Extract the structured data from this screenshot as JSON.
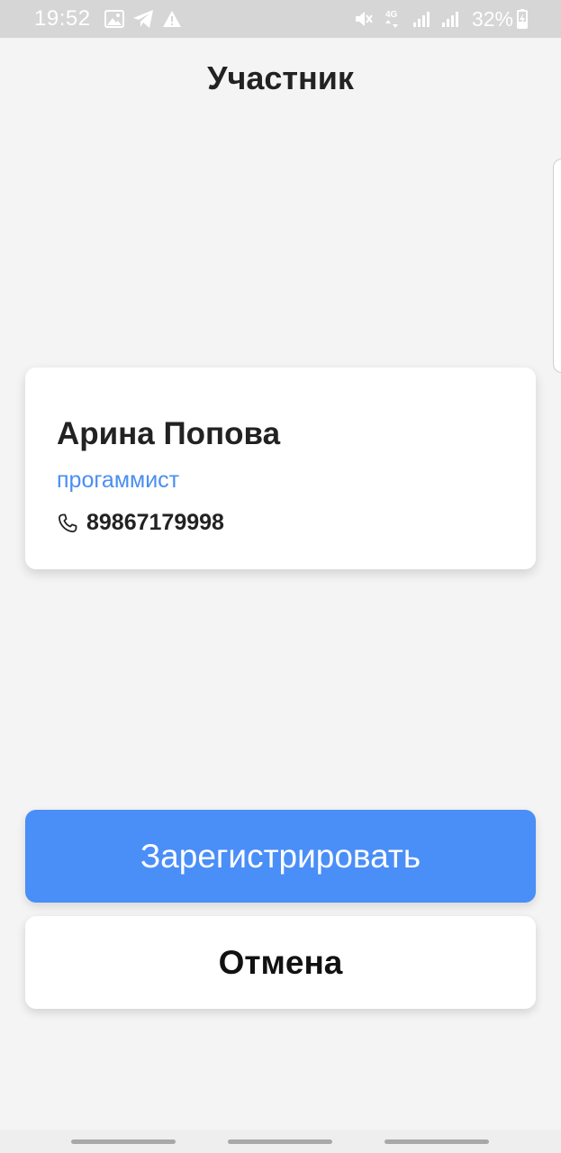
{
  "status_bar": {
    "time": "19:52",
    "battery": "32%",
    "network_label": "4G",
    "icons": [
      "image-icon",
      "telegram-icon",
      "warning-icon",
      "mute-icon",
      "network-4g-icon",
      "signal-icon",
      "signal-icon",
      "battery-charging-icon"
    ]
  },
  "page": {
    "title": "Участник"
  },
  "participant": {
    "name": "Арина Попова",
    "role": "прогаммист",
    "phone": "89867179998",
    "phone_icon": "phone-icon"
  },
  "actions": {
    "register_label": "Зарегистрировать",
    "cancel_label": "Отмена"
  },
  "colors": {
    "accent": "#4a8ef8",
    "role_text": "#4a8ef1",
    "background": "#f4f4f4",
    "status_bar": "#d6d6d6"
  }
}
